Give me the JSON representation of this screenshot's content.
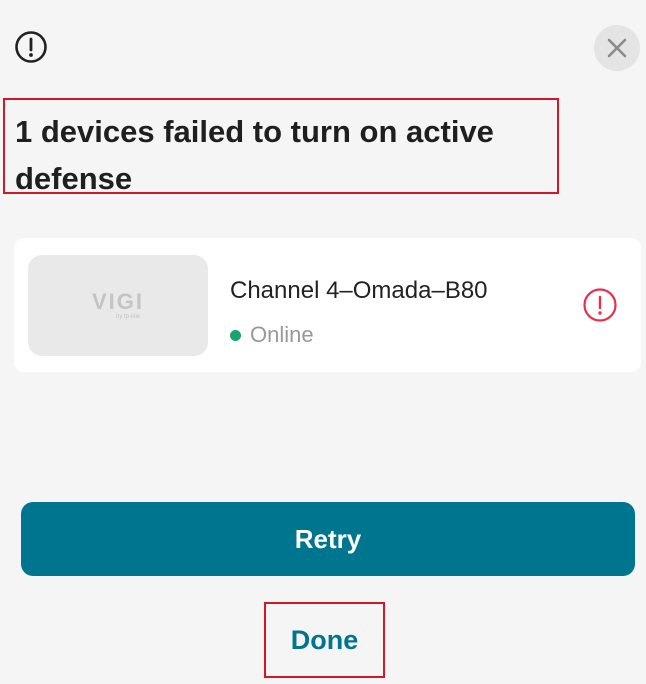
{
  "dialog": {
    "title": "1 devices failed to turn on active defense",
    "header_icon": "exclamation-circle-icon",
    "close_icon": "close-icon"
  },
  "device": {
    "thumbnail_logo": "VIGI",
    "thumbnail_logo_sub": "by tp-link",
    "name": "Channel 4–Omada–B80",
    "status": "Online",
    "status_color": "#1aa36b",
    "error_icon": "exclamation-circle-icon",
    "error_color": "#e5304f"
  },
  "actions": {
    "retry_label": "Retry",
    "done_label": "Done"
  },
  "colors": {
    "accent": "#00758f",
    "annotation_box": "#d0182a"
  }
}
